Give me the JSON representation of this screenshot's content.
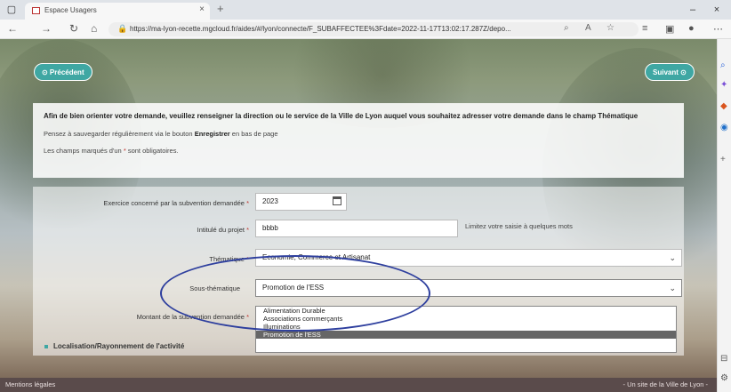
{
  "browser": {
    "tab_title": "Espace Usagers",
    "close_tab": "×",
    "new_tab": "+",
    "url": "https://ma-lyon-recette.mgcloud.fr/aides/#/lyon/connecte/F_SUBAFFECTEE%3Fdate=2022-11-17T13:02:17.287Z/depo..."
  },
  "nav": {
    "previous": "⊙ Précédent",
    "next": "Suivant ⊙"
  },
  "info": {
    "lead": "Afin de bien orienter votre demande, veuillez renseigner la direction ou le service de la Ville de Lyon auquel vous souhaitez adresser votre demande dans le champ Thématique",
    "save_prefix": "Pensez à sauvegarder régulièrement via le bouton ",
    "save_bold": "Enregistrer",
    "save_suffix": " en bas de page",
    "required_prefix": "Les champs marqués d'un ",
    "required_star": "*",
    "required_suffix": " sont obligatoires."
  },
  "form": {
    "exercice_label": "Exercice concerné par la subvention demandée",
    "exercice_value": "2023",
    "intitule_label": "Intitulé du projet",
    "intitule_value": "bbbb",
    "intitule_hint": "Limitez votre saisie à quelques mots",
    "thematique_label": "Thématique",
    "thematique_value": "Economie, Commerce et Artisanat",
    "sous_thematique_label": "Sous-thématique",
    "sous_thematique_value": "Promotion de l'ESS",
    "montant_label": "Montant de la subvention demandée",
    "star": "*",
    "sous_thematique_options": [
      "Alimentation Durable",
      "Associations commerçants",
      "Illuminations",
      "Promotion de l'ESS"
    ]
  },
  "section": {
    "localisation": "Localisation/Rayonnement de l'activité"
  },
  "footer": {
    "left": "Mentions légales",
    "right": "- Un site de la Ville de Lyon -"
  },
  "colors": {
    "accent": "#3fa7a3",
    "required": "#c0322b",
    "annotation": "#2e3f9e"
  }
}
